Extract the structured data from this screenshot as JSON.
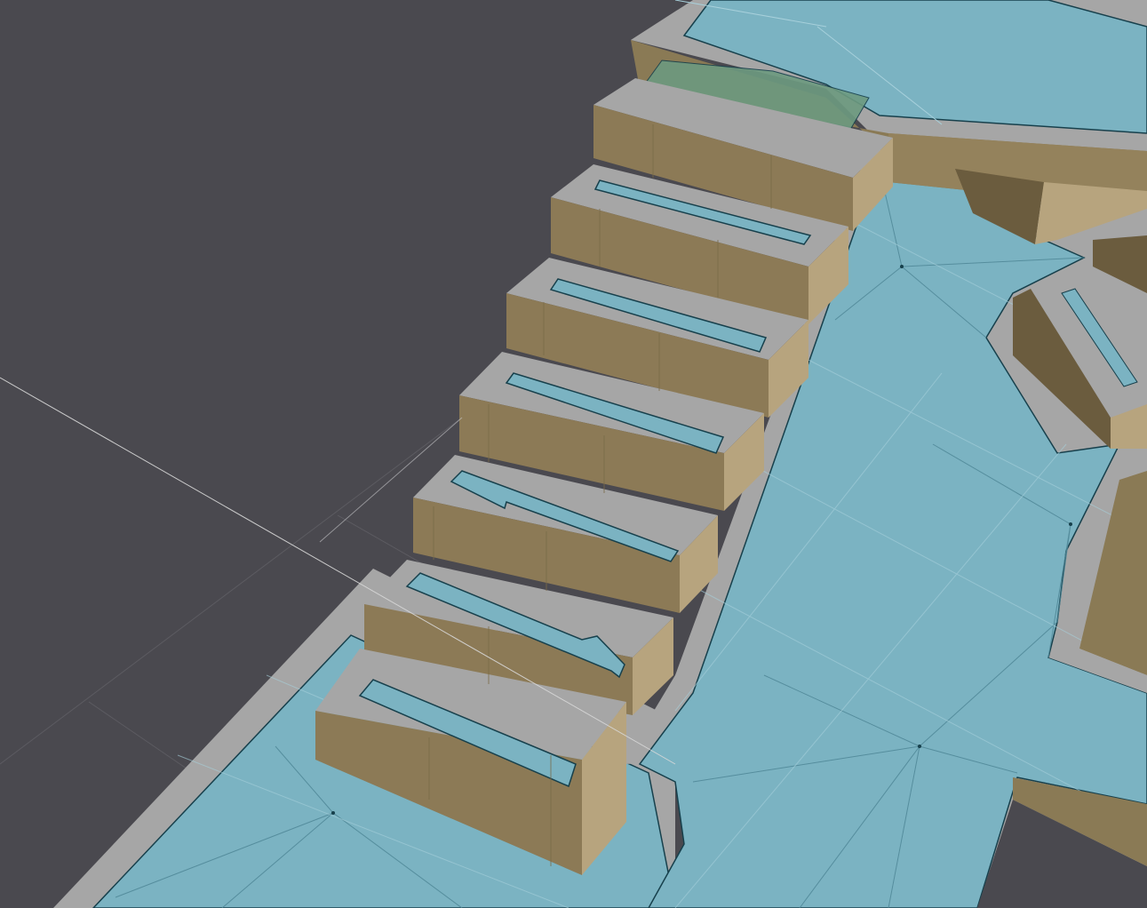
{
  "viewport": {
    "title": "",
    "background_color": "#4a494f",
    "colors": {
      "navmesh": "#7bb3c2",
      "navmesh_edge": "#17404c",
      "border_gray": "#a6a6a6",
      "wall_top": "#a4a4a4",
      "wall_side": "#8a7a55",
      "wall_side_light": "#a89570",
      "wall_side_dark": "#6b5c3e",
      "step_top": "#a6a6a6",
      "step_front": "#8c7a56",
      "step_side": "#b7a47e",
      "gizmo_line": "#d8d8d8",
      "grid_line": "#9ec7d2",
      "highlight": "#6d9a80"
    },
    "steps": 7
  }
}
